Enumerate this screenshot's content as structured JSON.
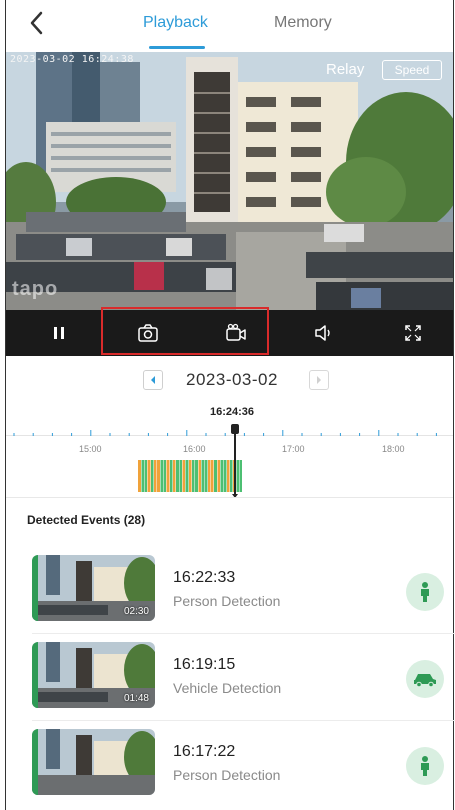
{
  "nav": {
    "back_label": "<",
    "tabs": [
      {
        "label": "Playback",
        "active": true
      },
      {
        "label": "Memory",
        "active": false
      }
    ],
    "accent_color": "#2d9bd8"
  },
  "video": {
    "timestamp_overlay": "2023-03-02 16:24:38",
    "relay_label": "Relay",
    "speed_label": "Speed",
    "watermark": "tapo"
  },
  "controls": {
    "items": [
      {
        "name": "pause-icon"
      },
      {
        "name": "camera-snapshot-icon"
      },
      {
        "name": "video-record-icon"
      },
      {
        "name": "speaker-icon"
      },
      {
        "name": "fullscreen-icon"
      }
    ],
    "highlight_color": "#d92b2b"
  },
  "date": {
    "value": "2023-03-02",
    "prev_icon": "chevron-left-icon",
    "next_icon": "chevron-right-icon"
  },
  "timeline": {
    "current_time": "16:24:36",
    "tick_labels": [
      "15:00",
      "16:00",
      "17:00",
      "18:00"
    ],
    "segment_colors": {
      "person": "#f0a23a",
      "vehicle": "#4cbf72"
    }
  },
  "events": {
    "title": "Detected Events",
    "count": "(28)",
    "items": [
      {
        "time": "16:22:33",
        "type": "Person Detection",
        "duration": "02:30",
        "icon": "person-icon"
      },
      {
        "time": "16:19:15",
        "type": "Vehicle Detection",
        "duration": "01:48",
        "icon": "car-icon"
      },
      {
        "time": "16:17:22",
        "type": "Person Detection",
        "duration": "",
        "icon": "person-icon"
      }
    ],
    "status_color": "#2e9a55"
  }
}
